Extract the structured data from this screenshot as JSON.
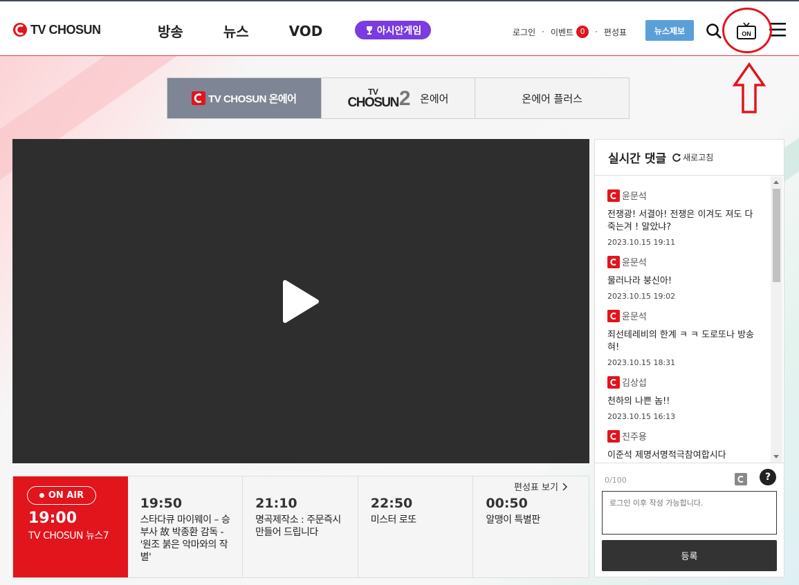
{
  "header": {
    "logo_text": "TV CHOSUN",
    "nav": [
      "방송",
      "뉴스",
      "VOD"
    ],
    "asian_games": "아시안게임",
    "util": {
      "login": "로그인",
      "event": "이벤트",
      "event_count": "0",
      "schedule": "편성표"
    },
    "report_button": "뉴스제보",
    "onair_icon_text": "ON"
  },
  "channel_tabs": [
    {
      "label": "TV CHOSUN 온에어"
    },
    {
      "logo": "TV CHOSUN2",
      "label": "온에어"
    },
    {
      "label": "온에어 플러스"
    }
  ],
  "channel2_logo": {
    "top": "TV",
    "main": "CHOSUN",
    "num": "2"
  },
  "schedule": {
    "more_label": "편성표 보기",
    "onair": {
      "badge": "ON AIR",
      "time": "19:00",
      "title": "TV CHOSUN 뉴스7"
    },
    "items": [
      {
        "time": "19:50",
        "title": "스타다큐 마이웨이 – 승부사 故 박종환 감독 -'원조 붉은 악마와의 작별'"
      },
      {
        "time": "21:10",
        "title": "명곡제작소 : 주문즉시 만들어 드립니다"
      },
      {
        "time": "22:50",
        "title": "미스터 로또"
      },
      {
        "time": "00:50",
        "title": "알맹이 특별판"
      }
    ]
  },
  "comments": {
    "title": "실시간 댓글",
    "refresh": "새로고침",
    "items": [
      {
        "user": "윤문석",
        "text": "전쟁광! 서결아! 전쟁은 이겨도 져도 다 죽는겨 ! 알았냐?",
        "date": "2023.10.15 19:11"
      },
      {
        "user": "윤문석",
        "text": "물러나라 붕신아!",
        "date": "2023.10.15 19:02"
      },
      {
        "user": "윤문석",
        "text": "죄선테레비의 한계 ㅋ ㅋ 도로또나 방송혀!",
        "date": "2023.10.15 18:31"
      },
      {
        "user": "김상섭",
        "text": "천하의 나쁜 놈!!",
        "date": "2023.10.15 16:13"
      },
      {
        "user": "진주용",
        "text": "이준석 제명서명적극참여합시다",
        "date": ""
      }
    ],
    "count": "0/100",
    "placeholder": "로그인 이후 작성 가능합니다.",
    "submit": "등록",
    "help": "?"
  }
}
